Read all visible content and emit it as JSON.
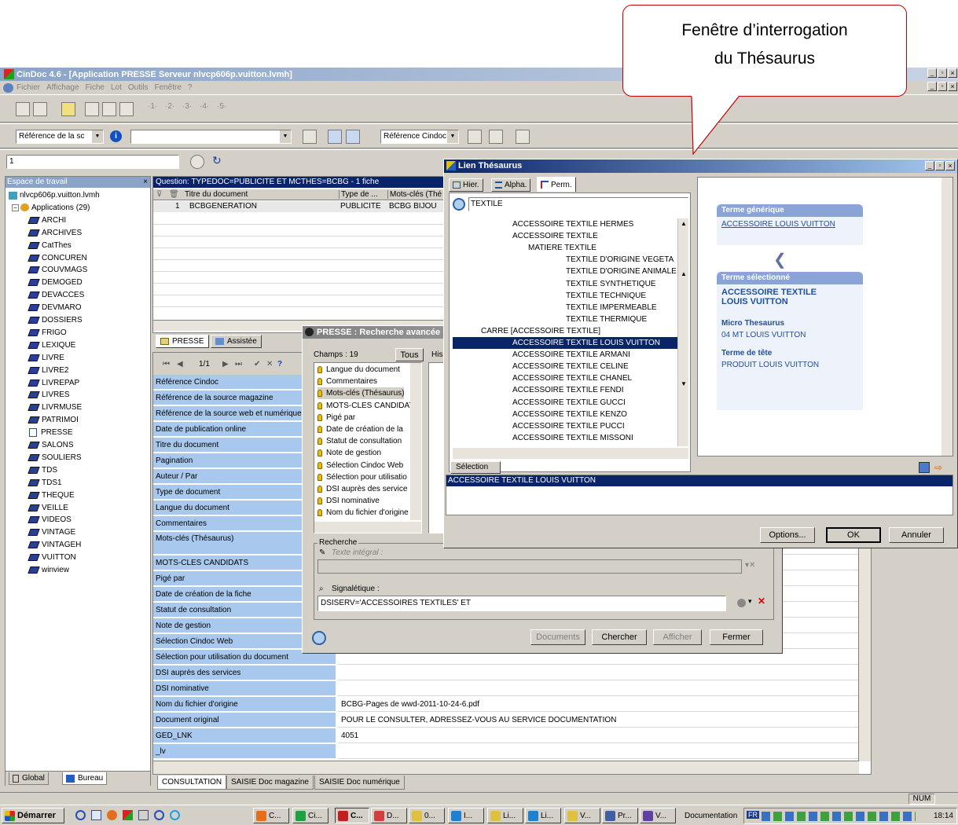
{
  "app": {
    "title": "CinDoc 4.6 - [Application PRESSE Serveur nlvcp606p.vuitton.lvmh]",
    "menu": [
      "Fichier",
      "Affichage",
      "Fiche",
      "Lot",
      "Outils",
      "Fenêtre",
      "?"
    ],
    "toolbar2": {
      "combo1": "Référence de la sc",
      "combo3": "Référence Cindoc"
    },
    "toolbar3": {
      "input": "1"
    }
  },
  "callout": {
    "line1": "Fenêtre d’interrogation",
    "line2": "du Thésaurus"
  },
  "workspace": {
    "title": "Espace de travail",
    "root": "nlvcp606p.vuitton.lvmh",
    "apps": "Applications (29)",
    "items": [
      "ARCHI",
      "ARCHIVES",
      "CatThes",
      "CONCUREN",
      "COUVMAGS",
      "DEMOGED",
      "DEVACCES",
      "DEVMARO",
      "DOSSIERS",
      "FRIGO",
      "LEXIQUE",
      "LIVRE",
      "LIVRE2",
      "LIVREPAP",
      "LIVRES",
      "LIVRMUSE",
      "PATRIMOI",
      "PRESSE",
      "SALONS",
      "SOULIERS",
      "TDS",
      "TDS1",
      "THEQUE",
      "VEILLE",
      "VIDEOS",
      "VINTAGE",
      "VINTAGEH",
      "VUITTON",
      "winview"
    ],
    "selected": "PRESSE",
    "tab_global": "Global",
    "tab_bureau": "Bureau"
  },
  "question": {
    "text": "Question: TYPEDOC=PUBLICITE ET MCTHES=BCBG - 1 fiche",
    "cols": [
      "Titre du document",
      "Type de ...",
      "Mots-clés (Thé"
    ],
    "row": {
      "num": "1",
      "title": "BCBGENERATION",
      "type": "PUBLICITE",
      "mots": "BCBG BIJOU"
    },
    "tab_presse": "PRESSE",
    "tab_assistee": "Assistée"
  },
  "record": {
    "nav": "1/1",
    "fields": [
      {
        "label": "Référence Cindoc",
        "value": ""
      },
      {
        "label": "Référence de la source magazine",
        "value": ""
      },
      {
        "label": "Référence de la source web et numérique",
        "value": ""
      },
      {
        "label": "Date de publication online",
        "value": ""
      },
      {
        "label": "Titre du document",
        "value": ""
      },
      {
        "label": "Pagination",
        "value": ""
      },
      {
        "label": "Auteur / Par",
        "value": ""
      },
      {
        "label": "Type de document",
        "value": ""
      },
      {
        "label": "Langue du document",
        "value": ""
      },
      {
        "label": "Commentaires",
        "value": ""
      },
      {
        "label": "Mots-clés (Thésaurus)",
        "value": ""
      },
      {
        "label": "MOTS-CLES CANDIDATS",
        "value": ""
      },
      {
        "label": "Pigé par",
        "value": ""
      },
      {
        "label": "Date de création de la fiche",
        "value": ""
      },
      {
        "label": "Statut de consultation",
        "value": ""
      },
      {
        "label": "Note de gestion",
        "value": ""
      },
      {
        "label": "Sélection Cindoc Web",
        "value": ""
      },
      {
        "label": "Sélection pour utilisation du document",
        "value": ""
      },
      {
        "label": "DSI auprès des services",
        "value": ""
      },
      {
        "label": "DSI nominative",
        "value": ""
      },
      {
        "label": "Nom du fichier d'origine",
        "value": "BCBG-Pages de wwd-2011-10-24-6.pdf"
      },
      {
        "label": "Document original",
        "value": "POUR LE CONSULTER, ADRESSEZ-VOUS AU SERVICE DOCUMENTATION"
      },
      {
        "label": "GED_LNK",
        "value": "4051"
      },
      {
        "label": "_lv",
        "value": ""
      }
    ],
    "tabs": [
      "CONSULTATION",
      "SAISIE Doc magazine",
      "SAISIE Doc numérique"
    ]
  },
  "search": {
    "title": "PRESSE : Recherche avancée",
    "champs": "Champs : 19",
    "tous": "Tous",
    "his": "His",
    "fields": [
      "Langue du document",
      "Commentaires",
      "Mots-clés (Thésaurus)",
      "MOTS-CLES CANDIDAT",
      "Pigé par",
      "Date de création de la",
      "Statut de consultation",
      "Note de gestion",
      "Sélection Cindoc Web",
      "Sélection pour utilisatio",
      "DSI auprès des service",
      "DSI nominative",
      "Nom du fichier d'origine"
    ],
    "recherche": "Recherche",
    "texte": "Texte intégral :",
    "signal": "Signalétique :",
    "query": "DSISERV='ACCESSOIRES TEXTILES' ET",
    "btn_documents": "Documents",
    "btn_chercher": "Chercher",
    "btn_afficher": "Afficher",
    "btn_fermer": "Fermer"
  },
  "thes": {
    "title": "Lien Thésaurus",
    "tab_hier": "Hier.",
    "tab_alpha": "Alpha.",
    "tab_perm": "Perm.",
    "search": "TEXTILE",
    "rows": [
      {
        "t": "ACCESSOIRE TEXTILE HERMES",
        "i": 76
      },
      {
        "t": "ACCESSOIRE TEXTILE",
        "i": 76
      },
      {
        "t": "MATIERE TEXTILE",
        "i": 96
      },
      {
        "t": "TEXTILE D'ORIGINE VEGETA",
        "i": 144
      },
      {
        "t": "TEXTILE D'ORIGINE ANIMALE",
        "i": 144
      },
      {
        "t": "TEXTILE SYNTHETIQUE",
        "i": 144
      },
      {
        "t": "TEXTILE TECHNIQUE",
        "i": 144
      },
      {
        "t": "TEXTILE IMPERMEABLE",
        "i": 144
      },
      {
        "t": "TEXTILE THERMIQUE",
        "i": 144
      },
      {
        "t": "CARRE [ACCESSOIRE TEXTILE]",
        "i": 36
      },
      {
        "t": "ACCESSOIRE TEXTILE LOUIS VUITTON",
        "i": 76
      },
      {
        "t": "ACCESSOIRE TEXTILE ARMANI",
        "i": 76
      },
      {
        "t": "ACCESSOIRE TEXTILE CELINE",
        "i": 76
      },
      {
        "t": "ACCESSOIRE TEXTILE CHANEL",
        "i": 76
      },
      {
        "t": "ACCESSOIRE TEXTILE FENDI",
        "i": 76
      },
      {
        "t": "ACCESSOIRE TEXTILE GUCCI",
        "i": 76
      },
      {
        "t": "ACCESSOIRE TEXTILE KENZO",
        "i": 76
      },
      {
        "t": "ACCESSOIRE TEXTILE PUCCI",
        "i": 76
      },
      {
        "t": "ACCESSOIRE TEXTILE MISSONI",
        "i": 76
      }
    ],
    "selected": "ACCESSOIRE TEXTILE LOUIS VUITTON",
    "generique_label": "Terme générique",
    "generique": "ACCESSOIRE LOUIS VUITTON",
    "sel_label": "Terme sélectionné",
    "sel1": "ACCESSOIRE TEXTILE",
    "sel2": "LOUIS VUITTON",
    "micro_label": "Micro Thesaurus",
    "micro": "04 MT LOUIS VUITTON",
    "tete_label": "Terme de tête",
    "tete": "PRODUIT LOUIS VUITTON",
    "selection_tab": "Sélection",
    "selection": "ACCESSOIRE TEXTILE LOUIS VUITTON",
    "btn_options": "Options...",
    "btn_ok": "OK",
    "btn_annuler": "Annuler"
  },
  "status": {
    "num": "NUM"
  },
  "taskbar": {
    "start": "Démarrer",
    "tasks": [
      "C...",
      "Ci...",
      "C...",
      "D...",
      "0...",
      "I...",
      "Li...",
      "Li...",
      "V...",
      "Pr...",
      "V..."
    ],
    "doc": "Documentation",
    "lang": "FR",
    "time": "18:14"
  },
  "colors": {
    "title_blue": "#0a246a",
    "select_blue": "#0a246a",
    "field_blue": "#a8c8ee",
    "panel_bg": "#d4d0c8"
  }
}
